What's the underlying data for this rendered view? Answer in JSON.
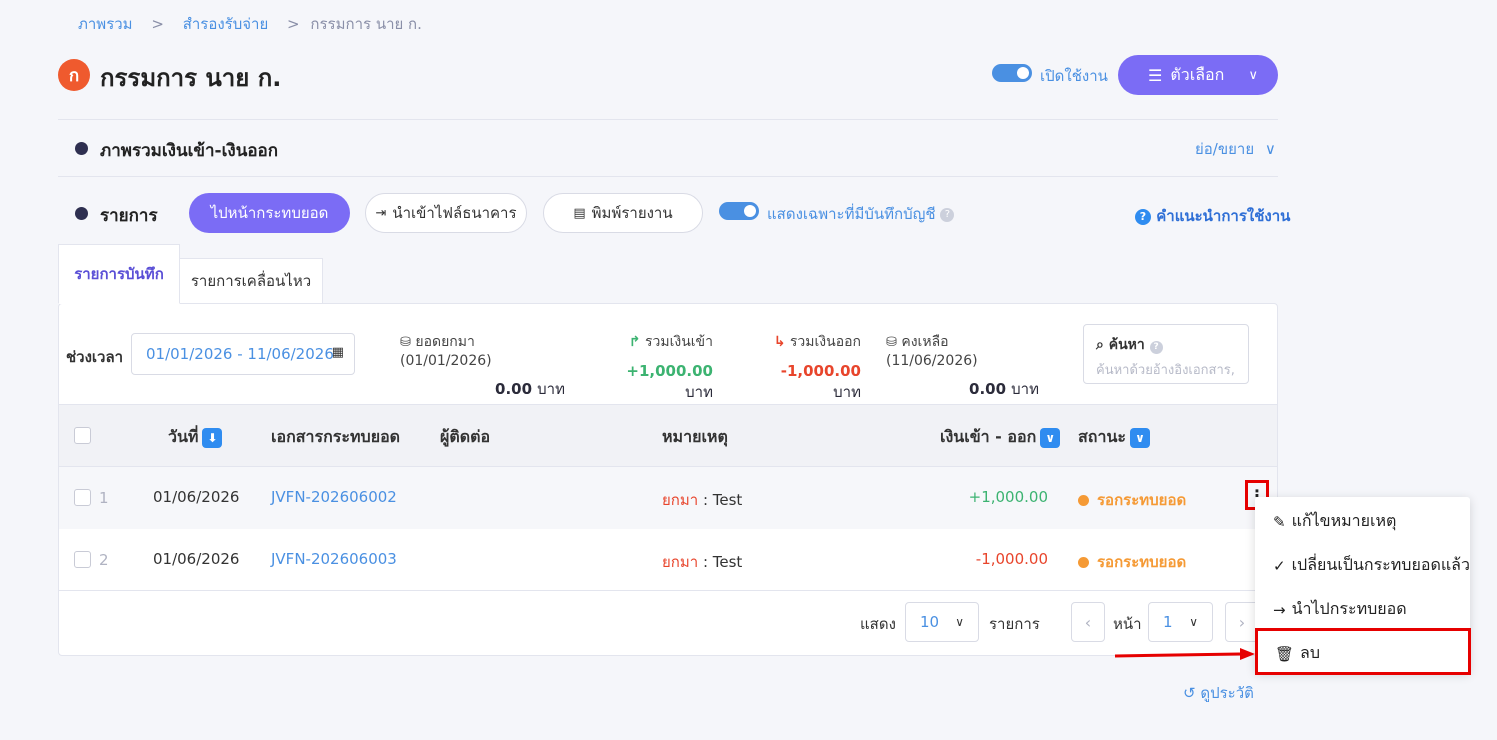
{
  "breadcrumb": {
    "home": "ภาพรวม",
    "section": "สำรองรับจ่าย",
    "current": "กรรมการ นาย ก.",
    "sep": ">"
  },
  "header": {
    "avatar_letter": "ก",
    "title": "กรรมการ นาย ก.",
    "enable_label": "เปิดใช้งาน",
    "options_label": "ตัวเลือก"
  },
  "overview": {
    "title": "ภาพรวมเงินเข้า-เงินออก",
    "collapse_label": "ย่อ/ขยาย"
  },
  "list_section": {
    "title": "รายการ",
    "goto_button": "ไปหน้ากระทบยอด",
    "import_button": "นำเข้าไฟล์ธนาคาร",
    "print_button": "พิมพ์รายงาน",
    "filter_toggle_label": "แสดงเฉพาะที่มีบันทึกบัญชี",
    "help_link": "คำแนะนำการใช้งาน"
  },
  "tabs": [
    {
      "label": "รายการบันทึก",
      "active": true
    },
    {
      "label": "รายการเคลื่อนไหว",
      "active": false
    }
  ],
  "filters": {
    "period_label": "ช่วงเวลา",
    "period_value": "01/01/2026 - 11/06/2026",
    "search_label": "ค้นหา",
    "search_placeholder": "ค้นหาด้วยอ้างอิงเอกสาร,"
  },
  "summary": {
    "carried": {
      "label": "ยอดยกมา (01/01/2026)",
      "value": "0.00",
      "unit": "บาท"
    },
    "income": {
      "label": "รวมเงินเข้า",
      "value": "+1,000.00",
      "unit": "บาท"
    },
    "expense": {
      "label": "รวมเงินออก",
      "value": "-1,000.00",
      "unit": "บาท"
    },
    "balance": {
      "label": "คงเหลือ (11/06/2026)",
      "value": "0.00",
      "unit": "บาท"
    }
  },
  "table": {
    "columns": {
      "date": "วันที่",
      "doc": "เอกสารกระทบยอด",
      "contact": "ผู้ติดต่อ",
      "note": "หมายเหตุ",
      "amount": "เงินเข้า - ออก",
      "status": "สถานะ"
    },
    "rows": [
      {
        "no": "1",
        "date": "01/06/2026",
        "doc": "JVFN-202606002",
        "contact": "",
        "note_prefix": "ยกมา",
        "note": " : Test",
        "amount": "+1,000.00",
        "status": "รอกระทบยอด"
      },
      {
        "no": "2",
        "date": "01/06/2026",
        "doc": "JVFN-202606003",
        "contact": "",
        "note_prefix": "ยกมา",
        "note": " : Test",
        "amount": "-1,000.00",
        "status": "รอกระทบยอด"
      }
    ]
  },
  "pagination": {
    "show_label": "แสดง",
    "page_size": "10",
    "items_label": "รายการ",
    "page_label": "หน้า",
    "page": "1"
  },
  "context_menu": {
    "edit_note": "แก้ไขหมายเหตุ",
    "mark_reconciled": "เปลี่ยนเป็นกระทบยอดแล้ว",
    "go_reconcile": "นำไปกระทบยอด",
    "delete": "ลบ"
  },
  "history_link": "ดูประวัติ",
  "colors": {
    "accent": "#7b6cf5",
    "link": "#4a90e2",
    "income": "#3cb371",
    "expense": "#e8452c",
    "pending": "#f59a35",
    "highlight": "#e60000"
  }
}
